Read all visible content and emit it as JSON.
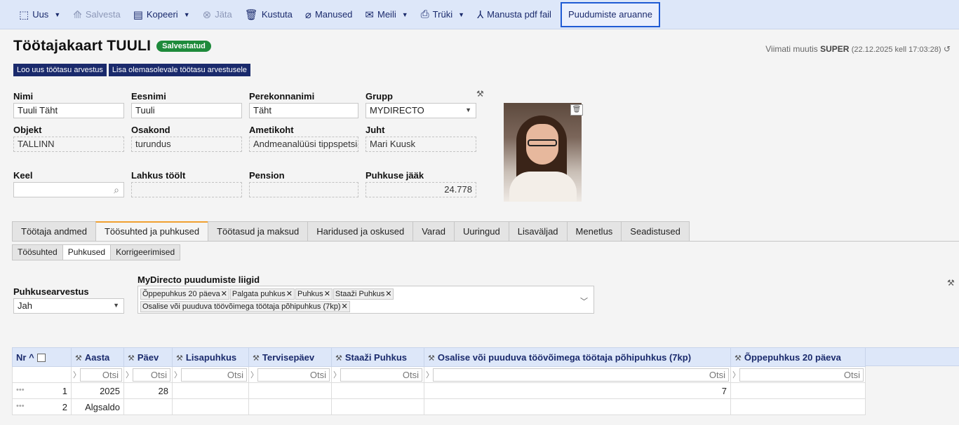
{
  "toolbar": {
    "new_label": "Uus",
    "save_label": "Salvesta",
    "copy_label": "Kopeeri",
    "skip_label": "Jäta",
    "delete_label": "Kustuta",
    "attachments_label": "Manused",
    "mail_label": "Meili",
    "print_label": "Trüki",
    "pdf_label": "Manusta pdf fail",
    "absence_report_label": "Puudumiste aruanne"
  },
  "header": {
    "title": "Töötajakaart TUULI",
    "status_badge": "Salvestatud",
    "modified_prefix": "Viimati muutis",
    "modified_user": "SUPER",
    "modified_when": "(22.12.2025 kell 17:03:28)"
  },
  "actions": {
    "new_salary_calc": "Loo uus töötasu arvestus",
    "add_to_salary_calc": "Lisa olemasolevale töötasu arvestusele"
  },
  "form": {
    "nimi": {
      "label": "Nimi",
      "value": "Tuuli Täht"
    },
    "eesnimi": {
      "label": "Eesnimi",
      "value": "Tuuli"
    },
    "perekonnanimi": {
      "label": "Perekonnanimi",
      "value": "Täht"
    },
    "grupp": {
      "label": "Grupp",
      "value": "MYDIRECTO"
    },
    "objekt": {
      "label": "Objekt",
      "value": "TALLINN"
    },
    "osakond": {
      "label": "Osakond",
      "value": "turundus"
    },
    "ametikoht": {
      "label": "Ametikoht",
      "value": "Andmeanalüüsi tippspetsialist"
    },
    "juht": {
      "label": "Juht",
      "value": "Mari Kuusk"
    },
    "keel": {
      "label": "Keel",
      "value": ""
    },
    "lahkus": {
      "label": "Lahkus töölt",
      "value": ""
    },
    "pension": {
      "label": "Pension",
      "value": ""
    },
    "puhkuse_jaak": {
      "label": "Puhkuse jääk",
      "value": "24.778"
    }
  },
  "tabs": [
    {
      "label": "Töötaja andmed"
    },
    {
      "label": "Töösuhted ja puhkused"
    },
    {
      "label": "Töötasud ja maksud"
    },
    {
      "label": "Haridused ja oskused"
    },
    {
      "label": "Varad"
    },
    {
      "label": "Uuringud"
    },
    {
      "label": "Lisaväljad"
    },
    {
      "label": "Menetlus"
    },
    {
      "label": "Seadistused"
    }
  ],
  "subtabs": [
    {
      "label": "Töösuhted"
    },
    {
      "label": "Puhkused"
    },
    {
      "label": "Korrigeerimised"
    }
  ],
  "vacation": {
    "calc_label": "Puhkusearvestus",
    "calc_value": "Jah",
    "types_label": "MyDirecto puudumiste liigid",
    "types": [
      "Õppepuhkus 20 päeva",
      "Palgata puhkus",
      "Puhkus",
      "Staaži Puhkus",
      "Osalise või puuduva töövõimega töötaja põhipuhkus (7kp)"
    ]
  },
  "grid": {
    "columns": [
      "Nr",
      "Aasta",
      "Päev",
      "Lisapuhkus",
      "Tervisepäev",
      "Staaži Puhkus",
      "Osalise või puuduva töövõimega töötaja põhipuhkus (7kp)",
      "Õppepuhkus 20 päeva"
    ],
    "filter_placeholder": "Otsi",
    "rows": [
      {
        "nr": "1",
        "aasta": "2025",
        "paev": "28",
        "lisapuhkus": "",
        "tervisepaev": "",
        "staazi": "",
        "osalise": "7",
        "oppepuhkus": ""
      },
      {
        "nr": "2",
        "aasta": "Algsaldo",
        "paev": "",
        "lisapuhkus": "",
        "tervisepaev": "",
        "staazi": "",
        "osalise": "",
        "oppepuhkus": ""
      }
    ]
  }
}
